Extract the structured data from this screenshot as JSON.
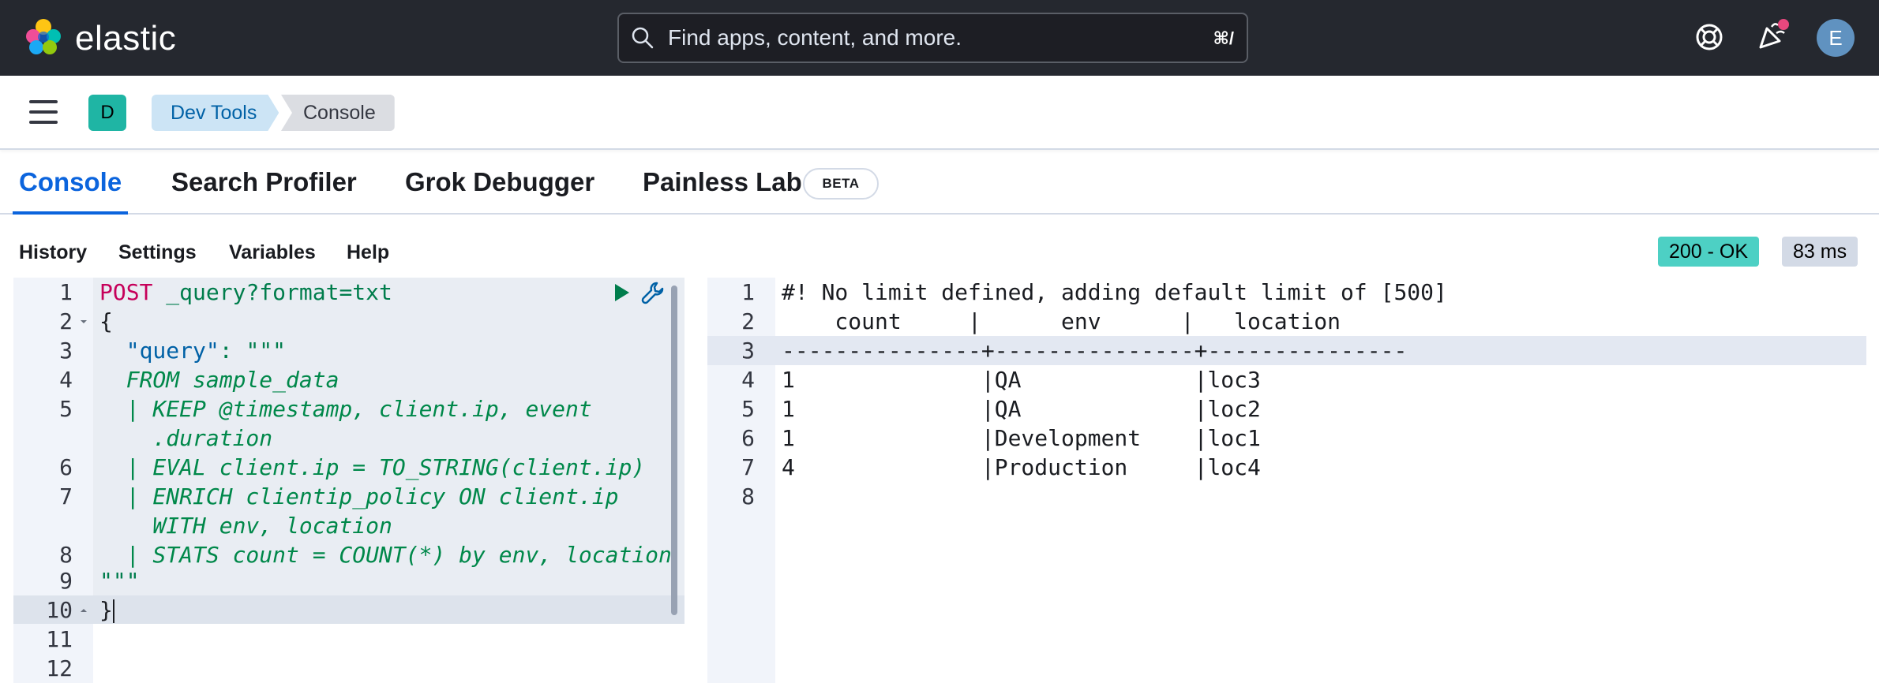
{
  "header": {
    "brand": "elastic",
    "search_placeholder": "Find apps, content, and more.",
    "search_shortcut": "⌘/",
    "avatar_initial": "E"
  },
  "breadcrumbs": {
    "space_initial": "D",
    "items": [
      "Dev Tools",
      "Console"
    ]
  },
  "tabs": [
    {
      "label": "Console",
      "active": true
    },
    {
      "label": "Search Profiler"
    },
    {
      "label": "Grok Debugger"
    },
    {
      "label": "Painless Lab",
      "badge": "BETA"
    }
  ],
  "toolbar": {
    "history": "History",
    "settings": "Settings",
    "variables": "Variables",
    "help": "Help",
    "status": "200 - OK",
    "duration": "83 ms"
  },
  "request": {
    "line_numbers": [
      "1",
      "2",
      "3",
      "4",
      "5",
      "",
      "6",
      "7",
      "",
      "8",
      "9",
      "10",
      "11",
      "12"
    ],
    "method": "POST",
    "path": " _query?format=txt",
    "open_brace": "{",
    "query_key": "\"query\"",
    "query_sep": ": \"\"\"",
    "esql": [
      "  FROM sample_data",
      "  | KEEP @timestamp, client.ip, event",
      "    .duration",
      "  | EVAL client.ip = TO_STRING(client.ip)",
      "  | ENRICH clientip_policy ON client.ip",
      "    WITH env, location",
      "  | STATS count = COUNT(*) by env, location"
    ],
    "close_triple": "\"\"\"",
    "close_brace": "}"
  },
  "response": {
    "line_numbers": [
      "1",
      "2",
      "3",
      "4",
      "5",
      "6",
      "7",
      "8"
    ],
    "lines": [
      "#! No limit defined, adding default limit of [500]",
      "    count     |      env      |   location",
      "---------------+---------------+---------------",
      "1              |QA             |loc3",
      "1              |QA             |loc2",
      "1              |Development    |loc1",
      "4              |Production     |loc4",
      ""
    ]
  },
  "colors": {
    "header_bg": "#25282f",
    "accent": "#0b64dd",
    "status_ok": "#4dd0c4"
  }
}
